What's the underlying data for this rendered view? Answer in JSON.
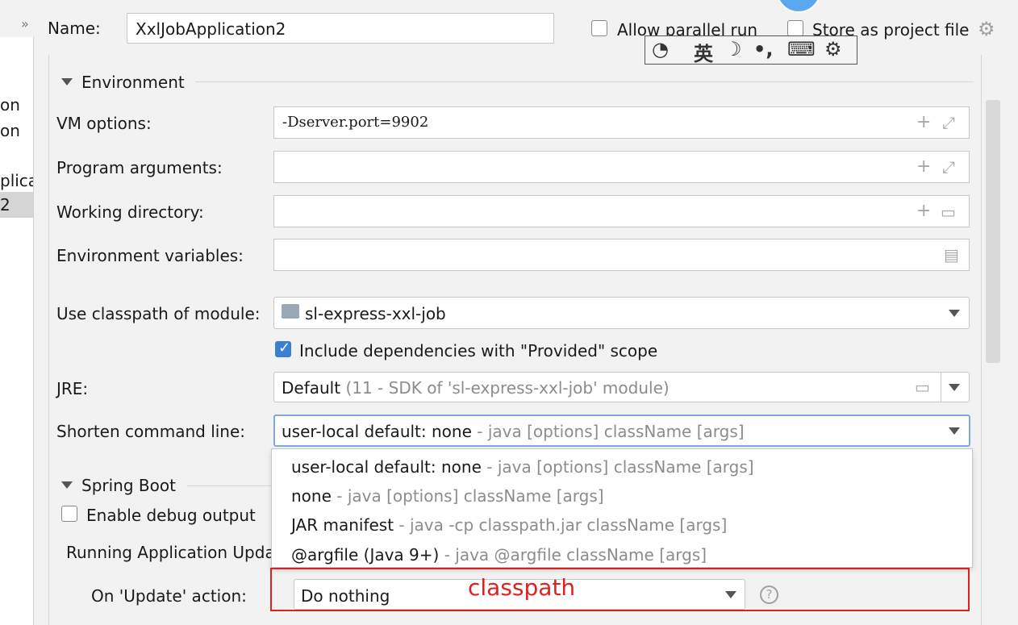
{
  "header": {
    "name_label": "Name:",
    "name_value": "XxlJobApplication2",
    "allow_parallel_label": "Allow parallel run",
    "store_project_label": "Store as project file"
  },
  "left_panel": {
    "items": [
      "on",
      "on",
      "plicat",
      "2"
    ]
  },
  "ime_toolbar": {
    "icons": [
      "ime-logo-icon",
      "english-mode-icon",
      "moon-icon",
      "punctuation-icon",
      "keyboard-icon",
      "settings-icon"
    ],
    "english_glyph": "英"
  },
  "environment": {
    "title": "Environment",
    "vm_options_label": "VM options:",
    "vm_options_value": "-Dserver.port=9902",
    "program_args_label": "Program arguments:",
    "working_dir_label": "Working directory:",
    "env_vars_label": "Environment variables:",
    "classpath_module_label": "Use classpath of module:",
    "classpath_module_value": "sl-express-xxl-job",
    "include_provided_label": "Include dependencies with \"Provided\" scope",
    "include_provided_checked": true,
    "jre_label": "JRE:",
    "jre_value_main": "Default",
    "jre_value_hint": "(11 - SDK of 'sl-express-xxl-job' module)",
    "shorten_label": "Shorten command line:",
    "shorten_value_main": "user-local default: none",
    "shorten_value_hint": "- java [options] className [args]"
  },
  "shorten_options": [
    {
      "main": "user-local default: none",
      "hint": "- java [options] className [args]"
    },
    {
      "main": "none",
      "hint": "- java [options] className [args]"
    },
    {
      "main": "JAR manifest",
      "hint": "- java -cp classpath.jar className [args]"
    },
    {
      "main": "@argfile (Java 9+)",
      "hint": "- java @argfile className [args]"
    }
  ],
  "spring_boot": {
    "title": "Spring Boot",
    "debug_label": "Enable debug output",
    "running_updates_label": "Running Application Upda",
    "on_update_label": "On 'Update' action:",
    "on_update_value": "Do nothing"
  },
  "annotation": {
    "text": "classpath",
    "color": "#e02020"
  },
  "colors": {
    "accent": "#3a7fd2",
    "focus_border": "#7fa9de",
    "hint_gray": "#8c8c8c"
  }
}
